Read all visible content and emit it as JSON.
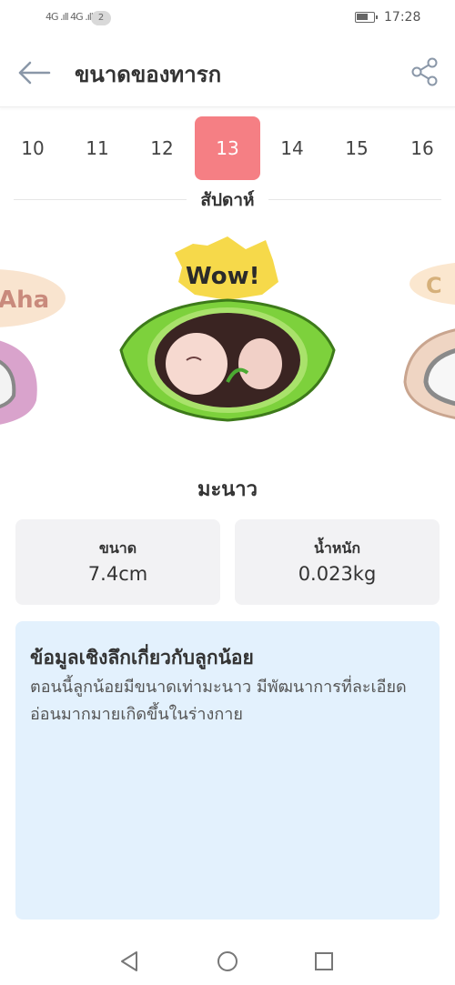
{
  "status_bar": {
    "signal_text": "4G .ıll 4G .ıll",
    "sim_count": "2",
    "battery_level": 0.7,
    "time": "17:28"
  },
  "header": {
    "title": "ขนาดของทารก",
    "back_icon": "arrow-left-icon",
    "share_icon": "share-icon"
  },
  "weeks": {
    "items": [
      "10",
      "11",
      "12",
      "13",
      "14",
      "15",
      "16"
    ],
    "selected": "13",
    "label": "สัปดาห์",
    "selected_color": "#f57f84"
  },
  "carousel": {
    "left_bubble": "Aha",
    "center_bubble": "Wow!",
    "right_bubble": "C"
  },
  "fruit": {
    "name": "มะนาว"
  },
  "stats": {
    "size_label": "ขนาด",
    "size_value": "7.4cm",
    "weight_label": "น้ำหนัก",
    "weight_value": "0.023kg"
  },
  "insight": {
    "title": "ข้อมูลเชิงลึกเกี่ยวกับลูกน้อย",
    "body": "ตอนนี้ลูกน้อยมีขนาดเท่ามะนาว มีพัฒนาการที่ละเอียดอ่อนมากมายเกิดขึ้นในร่างกาย"
  },
  "nav": {
    "back_icon": "triangle-back-icon",
    "home_icon": "circle-home-icon",
    "recents_icon": "square-recents-icon"
  }
}
